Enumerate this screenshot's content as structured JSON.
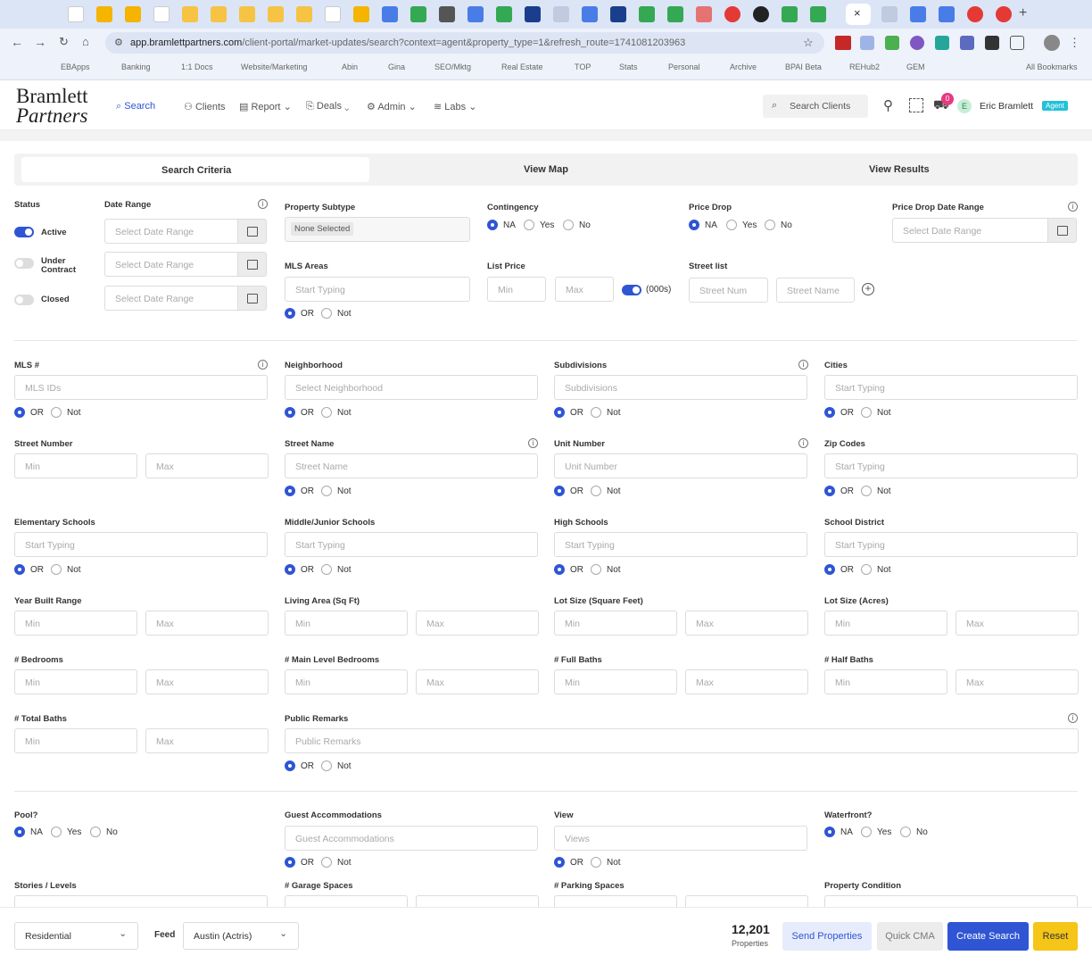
{
  "browser": {
    "url_host": "app.bramlettpartners.com",
    "url_path": "/client-portal/market-updates/search?context=agent&property_type=1&refresh_route=1741081203963",
    "bookmarks": [
      "EBApps",
      "Banking",
      "1:1 Docs",
      "Website/Marketing",
      "Abin",
      "Gina",
      "SEO/Mktg",
      "Real Estate",
      "TOP",
      "Stats",
      "Personal",
      "Archive",
      "BPAI Beta",
      "REHub2",
      "GEM",
      "All Bookmarks"
    ]
  },
  "brand": {
    "line1": "Bramlett",
    "line2": "Partners"
  },
  "nav": {
    "search": "Search",
    "clients": "Clients",
    "report": "Report",
    "deals": "Deals",
    "admin": "Admin",
    "labs": "Labs"
  },
  "header": {
    "search_clients": "Search Clients",
    "cart_count": "0",
    "avatar_letter": "E",
    "user_name": "Eric Bramlett",
    "badge": "Agent"
  },
  "tabs": {
    "criteria": "Search Criteria",
    "map": "View Map",
    "results": "View Results"
  },
  "labels": {
    "status": "Status",
    "date_range": "Date Range",
    "active": "Active",
    "under_contract": "Under Contract",
    "closed": "Closed",
    "select_date_range": "Select Date Range",
    "property_subtype": "Property Subtype",
    "none_selected": "None Selected",
    "contingency": "Contingency",
    "price_drop": "Price Drop",
    "price_drop_date": "Price Drop Date Range",
    "mls_areas": "MLS Areas",
    "list_price": "List Price",
    "street_list": "Street list",
    "thousands": "(000s)",
    "street_num": "Street Num",
    "street_name_ph": "Street Name",
    "mls": "MLS #",
    "mls_ph": "MLS IDs",
    "neighborhood": "Neighborhood",
    "neighborhood_ph": "Select Neighborhood",
    "subdivisions": "Subdivisions",
    "cities": "Cities",
    "street_number": "Street Number",
    "street_name": "Street Name",
    "unit_number": "Unit Number",
    "zip_codes": "Zip Codes",
    "elementary": "Elementary Schools",
    "middle": "Middle/Junior Schools",
    "high": "High Schools",
    "district": "School District",
    "year_built": "Year Built Range",
    "living_area": "Living Area (Sq Ft)",
    "lot_sqft": "Lot Size (Square Feet)",
    "lot_acres": "Lot Size (Acres)",
    "bedrooms": "# Bedrooms",
    "main_bedrooms": "# Main Level Bedrooms",
    "full_baths": "# Full Baths",
    "half_baths": "# Half Baths",
    "total_baths": "# Total Baths",
    "public_remarks": "Public Remarks",
    "pool": "Pool?",
    "guest": "Guest Accommodations",
    "view": "View",
    "waterfront": "Waterfront?",
    "stories": "Stories / Levels",
    "garage": "# Garage Spaces",
    "parking": "# Parking Spaces",
    "condition": "Property Condition",
    "start_typing": "Start Typing",
    "min": "Min",
    "max": "Max",
    "views_ph": "Views",
    "na": "NA",
    "yes": "Yes",
    "no": "No",
    "or": "OR",
    "not": "Not",
    "info": "i"
  },
  "footer": {
    "type": "Residential",
    "feed_label": "Feed",
    "feed": "Austin (Actris)",
    "count": "12,201",
    "count_label": "Properties",
    "send": "Send Properties",
    "cma": "Quick CMA",
    "create": "Create Search",
    "reset": "Reset"
  },
  "colors": {
    "accent": "#2f55d4",
    "reset": "#f5c518",
    "badge": "#22c1d9"
  }
}
